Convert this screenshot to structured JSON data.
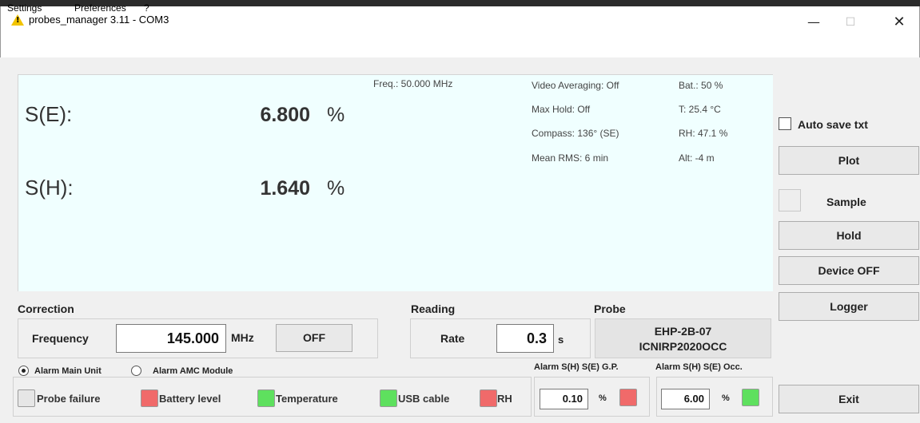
{
  "window": {
    "title": "probes_manager 3.11 - COM3",
    "controls": {
      "minimize": "—",
      "maximize": "☐",
      "close": "✕"
    }
  },
  "menu": {
    "items": [
      "Settings",
      "Preferences",
      "?"
    ]
  },
  "readings": {
    "se": {
      "label": "S(E):",
      "value": "6.800",
      "unit": "%"
    },
    "sh": {
      "label": "S(H):",
      "value": "1.640",
      "unit": "%"
    },
    "freq": "Freq.: 50.000 MHz",
    "video_averaging": "Video Averaging: Off",
    "max_hold": "Max Hold: Off",
    "compass": "Compass: 136° (SE)",
    "mean_rms": "Mean RMS: 6 min",
    "battery": "Bat.:  50 %",
    "temperature": "T: 25.4 °C",
    "humidity": "RH: 47.1 %",
    "altitude": "Alt: -4 m"
  },
  "side": {
    "auto_save": "Auto save txt",
    "plot": "Plot",
    "sample": "Sample",
    "hold": "Hold",
    "device_off": "Device OFF",
    "logger": "Logger",
    "exit": "Exit"
  },
  "correction": {
    "title": "Correction",
    "frequency_label": "Frequency",
    "frequency_value": "145.000",
    "frequency_unit": "MHz",
    "off_button": "OFF"
  },
  "reading": {
    "title": "Reading",
    "rate_label": "Rate",
    "rate_value": "0.3",
    "rate_unit": "s"
  },
  "probe": {
    "title": "Probe",
    "line1": "EHP-2B-07",
    "line2": "ICNIRP2020OCC"
  },
  "alarm_source": {
    "main_unit": "Alarm Main Unit",
    "amc_module": "Alarm AMC Module",
    "selected": "main_unit"
  },
  "status": [
    {
      "label": "Probe failure",
      "color": "#e6e6e6"
    },
    {
      "label": "Battery level",
      "color": "#f06a6a"
    },
    {
      "label": "Temperature",
      "color": "#5ee05e"
    },
    {
      "label": "USB cable",
      "color": "#5ee05e"
    },
    {
      "label": "RH",
      "color": "#f06a6a"
    }
  ],
  "alarm_gp": {
    "title": "Alarm S(H) S(E) G.P.",
    "value": "0.10",
    "unit": "%",
    "color": "#f06a6a"
  },
  "alarm_occ": {
    "title": "Alarm S(H) S(E) Occ.",
    "value": "6.00",
    "unit": "%",
    "color": "#5ee05e"
  }
}
